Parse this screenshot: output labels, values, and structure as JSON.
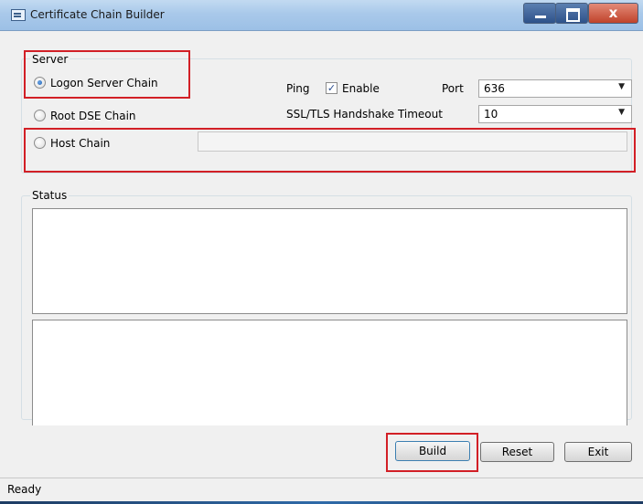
{
  "window": {
    "title": "Certificate Chain Builder",
    "controls": {
      "minimize": "",
      "maximize": "",
      "close": "x"
    }
  },
  "server": {
    "legend": "Server",
    "options": [
      {
        "label": "Logon Server Chain",
        "checked": true
      },
      {
        "label": "Root DSE Chain",
        "checked": false
      },
      {
        "label": "Host Chain",
        "checked": false
      }
    ],
    "ping_label": "Ping",
    "enable_label": "Enable",
    "enable_checked": true,
    "enable_mark": "✓",
    "port_label": "Port",
    "port_value": "636",
    "timeout_label": "SSL/TLS Handshake Timeout",
    "timeout_value": "10",
    "host_value": ""
  },
  "status": {
    "legend": "Status",
    "text1": "",
    "text2": ""
  },
  "buttons": {
    "build": "Build",
    "reset": "Reset",
    "exit": "Exit"
  },
  "statusbar": {
    "text": "Ready"
  },
  "icons": {
    "dropdown": "▼"
  },
  "colors": {
    "highlight": "#d21f26",
    "titlebar": "#a9c9ea"
  }
}
